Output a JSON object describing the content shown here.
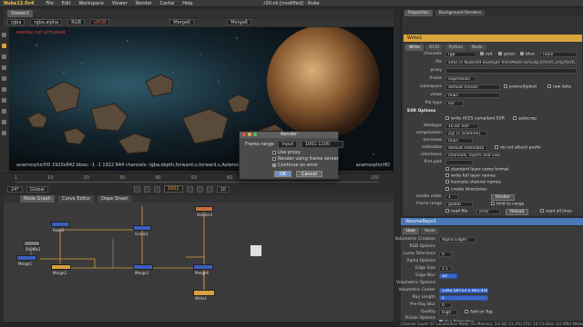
{
  "app": {
    "name": "Nuke12.0v4",
    "window_title": "r20.nk [modified] - Nuke",
    "menu": [
      "File",
      "Edit",
      "Workspace",
      "Viewer",
      "Render",
      "Cache",
      "Help"
    ]
  },
  "viewer": {
    "tab": "Viewer1",
    "toolbar": {
      "layer": "rgba",
      "channel": "rgba.alpha",
      "color": "RGB",
      "lut": "sRGB",
      "input_a": "Merge6",
      "input_b": "Merge6"
    },
    "overlay_warning": "overlay not activated",
    "format_label": "anamorphicHD",
    "info_line": "anamorphicHD 1920x842  bbox: -1 -1 1922 844 channels: rgba,depth,forward.u,forward.v,AsteroidRGI_Lax  x=0 y=0"
  },
  "timeline": {
    "ticks": [
      "1",
      "10",
      "20",
      "30",
      "40",
      "50",
      "60",
      "70",
      "80",
      "90",
      "100"
    ],
    "fps": "24*",
    "mode": "Global",
    "current_frame": "1001",
    "step": "10"
  },
  "nodegraph": {
    "tabs": [
      "Node Graph",
      "Curve Editor",
      "Dope Sheet"
    ],
    "nodes": [
      "Read1",
      "Shuffle1",
      "Merge1",
      "Grade1",
      "Merge2",
      "Merge3",
      "Merge6",
      "Write1",
      "Volume1"
    ]
  },
  "properties": {
    "tabs": [
      "Properties",
      "Background Renders"
    ],
    "node_title": "Write1",
    "subtabs": [
      "Write",
      "OCIO",
      "Python",
      "Node"
    ],
    "fields": {
      "channels": "rgb",
      "channel_checks": [
        "red",
        "green",
        "blue"
      ],
      "alpha": "none",
      "file": "vmis in Nuke/09 example files/Material/output/testComp/testComp.####.exr",
      "proxy": "",
      "frame": "expression",
      "colorspace": "default (linear)",
      "premultiplied": "premultiplied",
      "raw_data": "raw data",
      "views": "main",
      "file_type": "exr"
    },
    "exr_section": "EXR Options",
    "exr": {
      "write_aces": "write ACES compliant EXR",
      "autocrop": "autocrop",
      "datatype": "16 bit half",
      "compression": "Zip (1 scanline)",
      "heroview": "main",
      "metadata": "default metadata",
      "do_not_attach": "do not attach prefix",
      "interleave": "channels, layers and views",
      "first_part": "",
      "std_layer": "standard layer name format",
      "write_full": "write full layer names",
      "truncate": "truncate channel names",
      "create_dirs": "create directories"
    },
    "render_order": "1",
    "render_button": "Render",
    "frame_range": "global",
    "limit_to_range": "limit to range",
    "read_file": "read file",
    "missing_frames": "error",
    "reload": "Reload",
    "read_all_lines": "read all lines"
  },
  "volumerays": {
    "title": "VolumeRays1",
    "subtabs": [
      "User",
      "Node"
    ],
    "creation_label": "Volumetric Creation",
    "creation_value": "Alpha Edges",
    "rows": [
      {
        "k": "RGB Options",
        "v": ""
      },
      {
        "k": "Luma Tolerance",
        "v": "0"
      },
      {
        "k": "Alpha Options",
        "v": ""
      },
      {
        "k": "Edge Size",
        "v": "1.1"
      },
      {
        "k": "Edge Blur",
        "v": "10"
      },
      {
        "k": "Volumetric Options",
        "v": ""
      },
      {
        "k": "Volumetric Center",
        "v": "1392.59753  x  461.456342"
      },
      {
        "k": "Ray Length",
        "v": "1"
      },
      {
        "k": "Pre-Ray Blur",
        "v": "0"
      },
      {
        "k": "Quality",
        "v": "High"
      },
      {
        "k": "Flicker Options",
        "v": ""
      }
    ],
    "add_on_top": "Add on Top",
    "use_flicker": "Use Flickerline"
  },
  "render_dialog": {
    "title": "Render",
    "frame_range_label": "Frame range",
    "frame_range_mode": "Input",
    "frame_range_value": "1001-1100",
    "use_proxy": "Use proxy",
    "render_frame_server": "Render using frame server",
    "continue_on_error": "Continue on error",
    "ok": "OK",
    "cancel": "Cancel"
  },
  "status": "Channel Count: 67  Localisation Mode: On  Memory: 3.6 GB (11.4%)  CPU: 14.1%  Disk: 0.0 MB/s  Network: 0.0 MB/s"
}
